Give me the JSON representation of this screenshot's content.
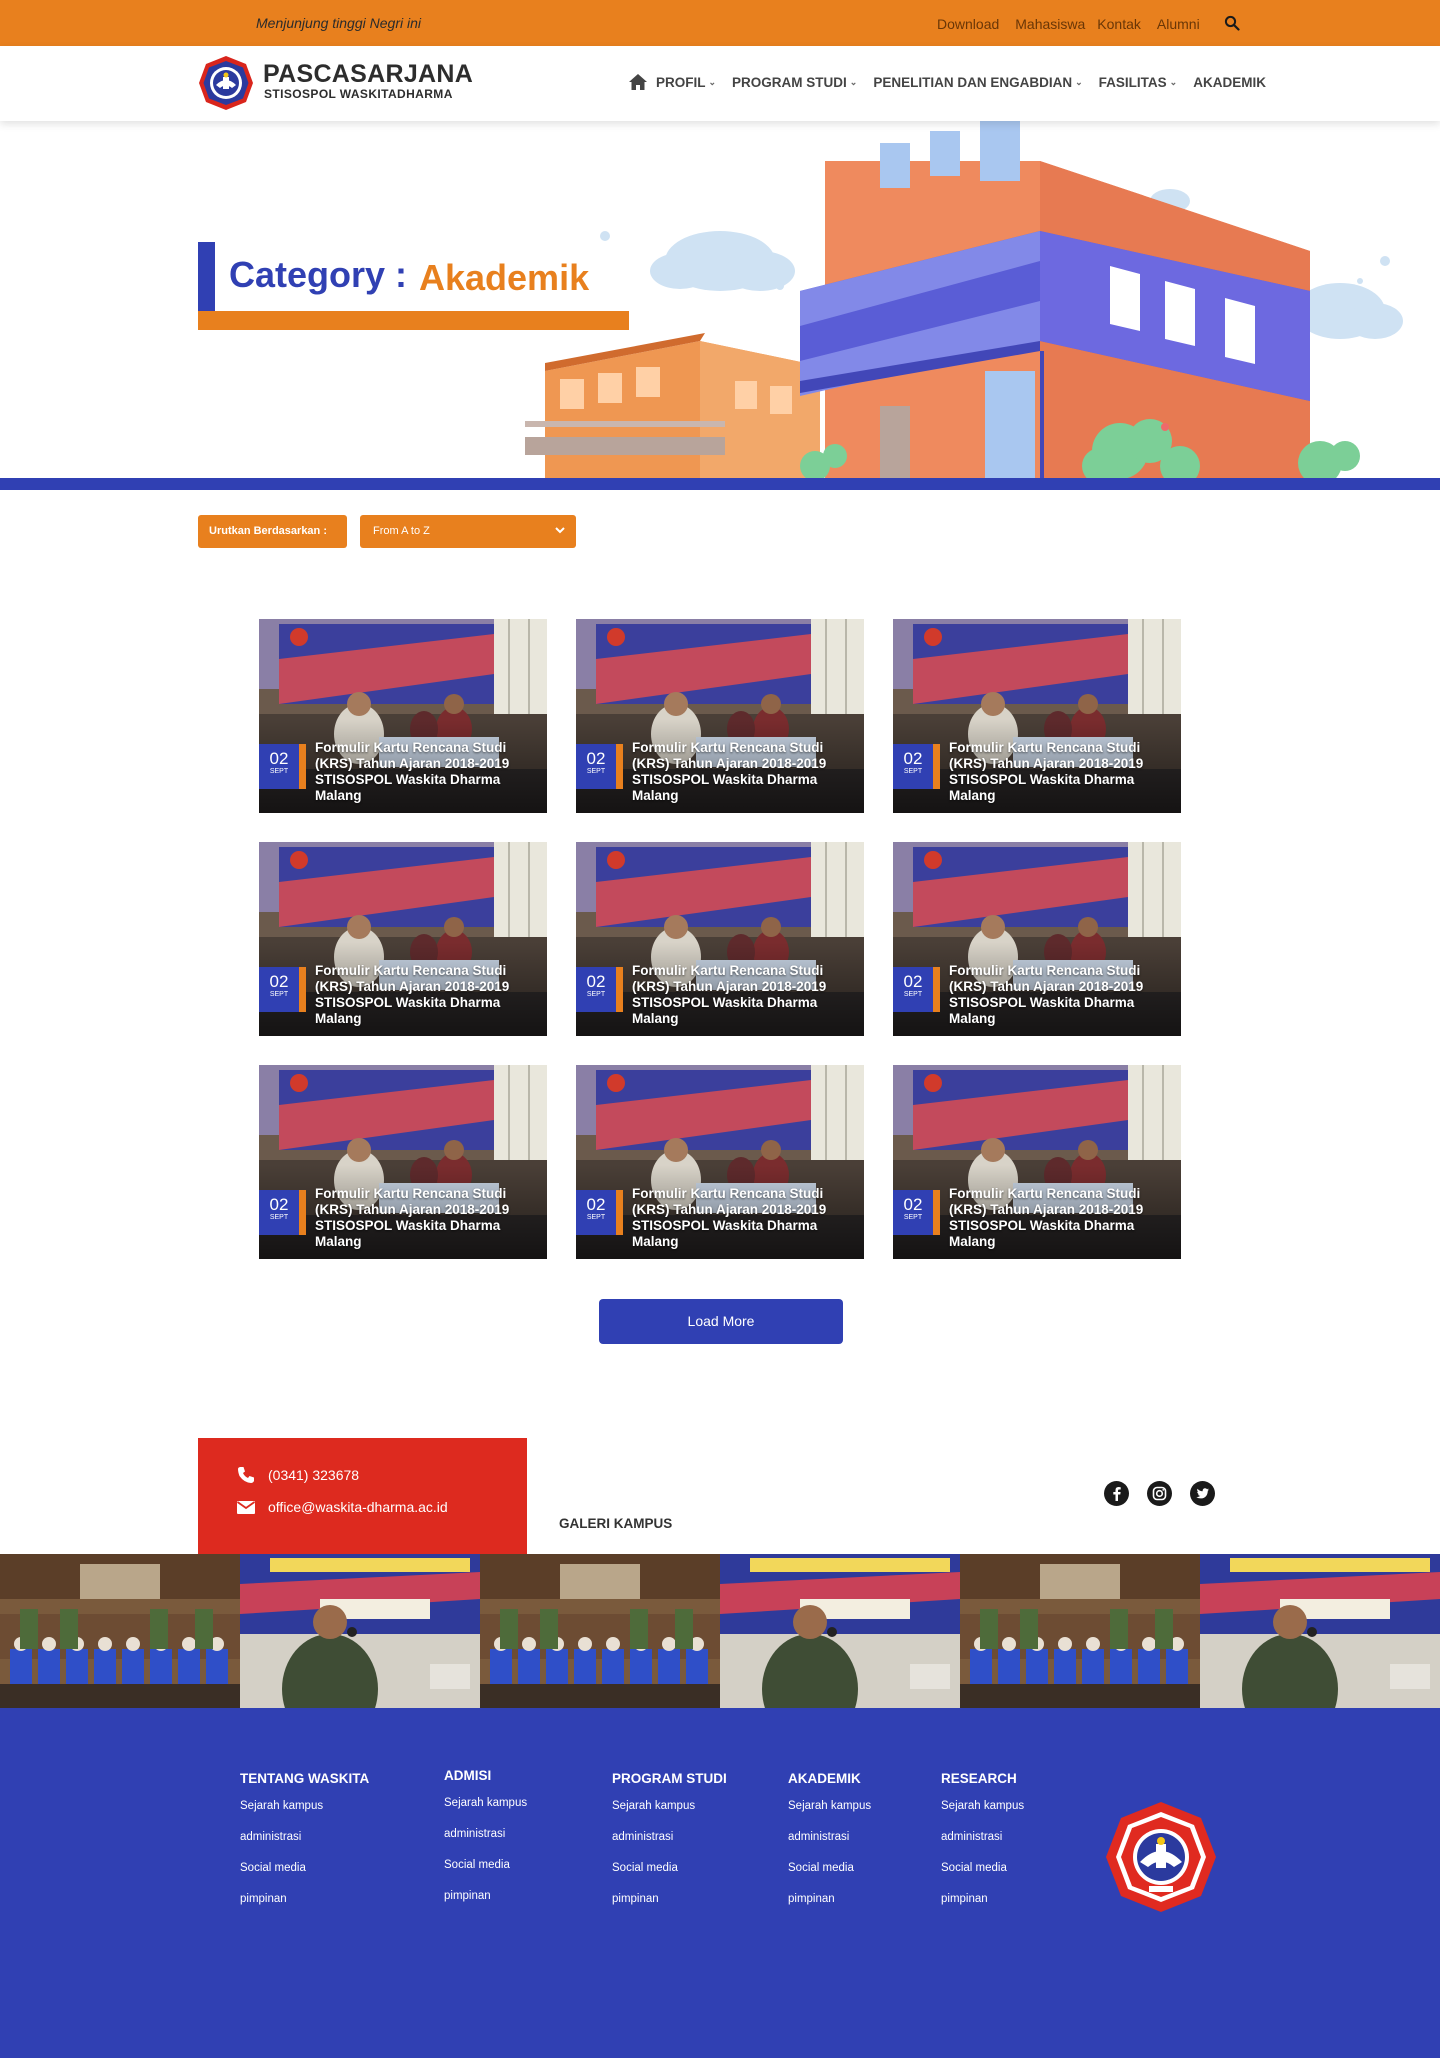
{
  "topbar": {
    "tagline": "Menjunjung tinggi Negri ini",
    "links": [
      "Download",
      "Mahasiswa",
      "Kontak",
      "Alumni"
    ]
  },
  "header": {
    "brand_title": "PASCASARJANA",
    "brand_subtitle": "STISOSPOL WASKITADHARMA",
    "nav": [
      "PROFIL",
      "PROGRAM STUDI",
      "PENELITIAN DAN ENGABDIAN",
      "FASILITAS",
      "AKADEMIK"
    ]
  },
  "hero": {
    "category_label": "Category :",
    "category_value": "Akademik"
  },
  "sort": {
    "label": "Urutkan Berdasarkan :",
    "selected": "From A to Z"
  },
  "posts": [
    {
      "day": "02",
      "month": "SEPT",
      "title": "Formulir Kartu Rencana Studi (KRS) Tahun Ajaran 2018-2019 STISOSPOL Waskita Dharma Malang"
    },
    {
      "day": "02",
      "month": "SEPT",
      "title": "Formulir Kartu Rencana Studi (KRS) Tahun Ajaran 2018-2019 STISOSPOL Waskita Dharma Malang"
    },
    {
      "day": "02",
      "month": "SEPT",
      "title": "Formulir Kartu Rencana Studi (KRS) Tahun Ajaran 2018-2019 STISOSPOL Waskita Dharma Malang"
    },
    {
      "day": "02",
      "month": "SEPT",
      "title": "Formulir Kartu Rencana Studi (KRS) Tahun Ajaran 2018-2019 STISOSPOL Waskita Dharma Malang"
    },
    {
      "day": "02",
      "month": "SEPT",
      "title": "Formulir Kartu Rencana Studi (KRS) Tahun Ajaran 2018-2019 STISOSPOL Waskita Dharma Malang"
    },
    {
      "day": "02",
      "month": "SEPT",
      "title": "Formulir Kartu Rencana Studi (KRS) Tahun Ajaran 2018-2019 STISOSPOL Waskita Dharma Malang"
    },
    {
      "day": "02",
      "month": "SEPT",
      "title": "Formulir Kartu Rencana Studi (KRS) Tahun Ajaran 2018-2019 STISOSPOL Waskita Dharma Malang"
    },
    {
      "day": "02",
      "month": "SEPT",
      "title": "Formulir Kartu Rencana Studi (KRS) Tahun Ajaran 2018-2019 STISOSPOL Waskita Dharma Malang"
    },
    {
      "day": "02",
      "month": "SEPT",
      "title": "Formulir Kartu Rencana Studi (KRS) Tahun Ajaran 2018-2019 STISOSPOL Waskita Dharma Malang"
    }
  ],
  "load_more": "Load More",
  "contact": {
    "phone": "(0341) 323678",
    "email": "office@waskita-dharma.ac.id"
  },
  "gallery_title": "GALERI KAMPUS",
  "social_icons": [
    "facebook-icon",
    "instagram-icon",
    "twitter-icon"
  ],
  "footer": {
    "columns": [
      {
        "heading": "TENTANG WASKITA",
        "links": [
          "Sejarah kampus",
          "administrasi",
          "Social media",
          "pimpinan"
        ]
      },
      {
        "heading": "ADMISI",
        "links": [
          "Sejarah kampus",
          "administrasi",
          "Social media",
          "pimpinan"
        ]
      },
      {
        "heading": "PROGRAM STUDI",
        "links": [
          "Sejarah kampus",
          "administrasi",
          "Social media",
          "pimpinan"
        ]
      },
      {
        "heading": "AKADEMIK",
        "links": [
          "Sejarah kampus",
          "administrasi",
          "Social media",
          "pimpinan"
        ]
      },
      {
        "heading": "RESEARCH",
        "links": [
          "Sejarah kampus",
          "administrasi",
          "Social media",
          "pimpinan"
        ]
      }
    ]
  },
  "colors": {
    "orange": "#e8801e",
    "blue": "#3040b3",
    "red": "#dd2a1f"
  }
}
